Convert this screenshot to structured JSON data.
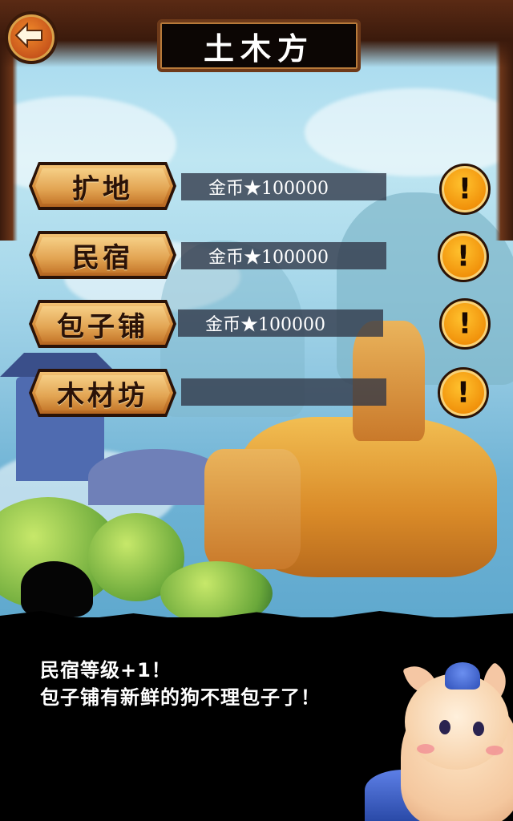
{
  "screen": {
    "title": "土木方"
  },
  "rows": [
    {
      "label": "扩地",
      "cost": "金币★100000"
    },
    {
      "label": "民宿",
      "cost": "金币★100000"
    },
    {
      "label": "包子铺",
      "cost": "金币★100000"
    },
    {
      "label": "木材坊",
      "cost": ""
    }
  ],
  "dialog": {
    "line1": "民宿等级+1！",
    "line2": "包子铺有新鲜的狗不理包子了！"
  },
  "icons": {
    "back": "arrow-left-icon",
    "info": "exclamation-icon"
  },
  "colors": {
    "accent_orange": "#f08e08",
    "label_gold": "#e2a452",
    "frame_brown": "#6e3a1a",
    "cost_bar": "#303646"
  }
}
